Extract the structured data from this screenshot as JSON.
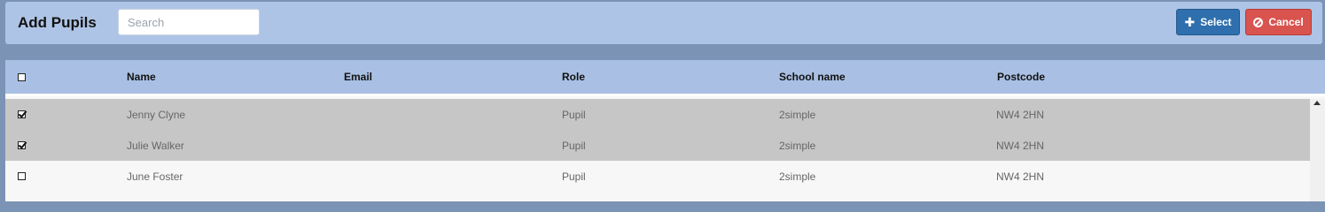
{
  "header": {
    "title": "Add Pupils",
    "search_placeholder": "Search",
    "search_value": "",
    "select_label": "Select",
    "cancel_label": "Cancel"
  },
  "table": {
    "columns": [
      "Name",
      "Email",
      "Role",
      "School name",
      "Postcode"
    ],
    "rows": [
      {
        "checked": true,
        "name": "Jenny Clyne",
        "email": "",
        "role": "Pupil",
        "school": "2simple",
        "postcode": "NW4 2HN"
      },
      {
        "checked": true,
        "name": "Julie Walker",
        "email": "",
        "role": "Pupil",
        "school": "2simple",
        "postcode": "NW4 2HN"
      },
      {
        "checked": false,
        "name": "June Foster",
        "email": "",
        "role": "Pupil",
        "school": "2simple",
        "postcode": "NW4 2HN"
      }
    ]
  },
  "colors": {
    "header_bar": "#aec4e6",
    "select_button": "#2f6fad",
    "cancel_button": "#d9534f",
    "selected_row": "#c6c6c6"
  },
  "icons": {
    "select": "plus-icon",
    "cancel": "ban-icon"
  }
}
